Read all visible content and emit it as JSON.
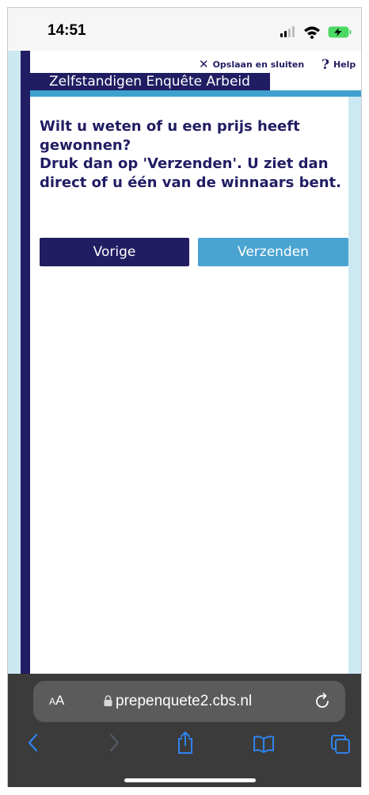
{
  "status_bar": {
    "time": "14:51",
    "icons": [
      "signal-icon",
      "wifi-icon",
      "battery-charging-icon"
    ]
  },
  "survey": {
    "links": {
      "save_close_symbol": "✕",
      "save_close": "Opslaan en sluiten",
      "help_symbol": "?",
      "help": "Help"
    },
    "title": "Zelfstandigen Enquête Arbeid",
    "question_lines": [
      "Wilt u weten of u een prijs heeft gewonnen?",
      "Druk dan op 'Verzenden'. U ziet dan direct of u één van de winnaars bent."
    ],
    "buttons": {
      "previous": "Vorige",
      "submit": "Verzenden"
    }
  },
  "browser": {
    "text_size_label_small": "A",
    "text_size_label_large": "A",
    "url": "prepenquete2.cbs.nl",
    "toolbar_icons": [
      "back-icon",
      "forward-icon",
      "share-icon",
      "bookmarks-icon",
      "tabs-icon"
    ]
  },
  "colors": {
    "navy": "#211d63",
    "accent_blue": "#4aa3d0",
    "stripe_blue": "#3fa1cf",
    "rail_light_blue": "#cce8f2",
    "toolbar_dark": "#3b3b3b"
  }
}
